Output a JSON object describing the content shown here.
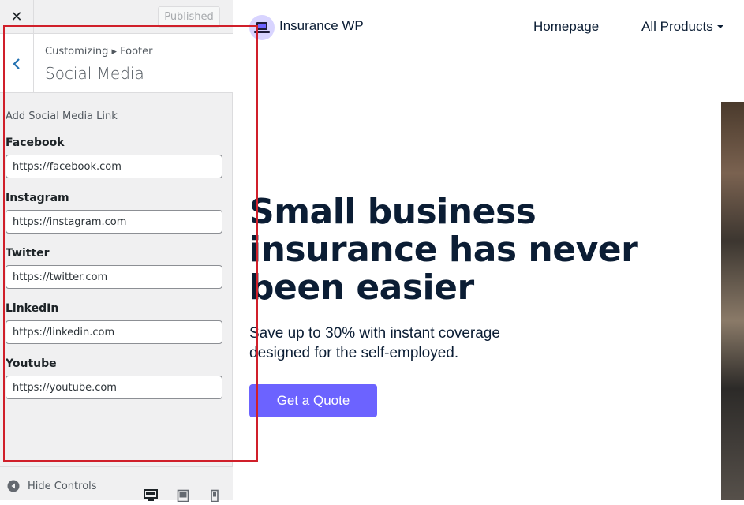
{
  "sidebar": {
    "close_label": "✕",
    "publish_label": "Published",
    "breadcrumb": "Customizing ▸ Footer",
    "section_title": "Social Media",
    "controls_description": "Add Social Media Link",
    "fields": [
      {
        "label": "Facebook",
        "value": "https://facebook.com"
      },
      {
        "label": "Instagram",
        "value": "https://instagram.com"
      },
      {
        "label": "Twitter",
        "value": "https://twitter.com"
      },
      {
        "label": "LinkedIn",
        "value": "https://linkedin.com"
      },
      {
        "label": "Youtube",
        "value": "https://youtube.com"
      }
    ],
    "hide_controls_label": "Hide Controls",
    "devices": [
      "desktop-icon",
      "tablet-icon",
      "mobile-icon"
    ]
  },
  "preview": {
    "brand_name": "Insurance WP",
    "nav": {
      "home": "Homepage",
      "products": "All Products"
    },
    "hero": {
      "title": "Small business insurance has never been easier",
      "subtitle": "Save up to 30% with instant coverage designed for the self-employed.",
      "cta_label": "Get a Quote"
    }
  },
  "colors": {
    "accent": "#6c63ff",
    "highlight": "#d01f2a",
    "heading": "#0b1d34",
    "wp_blue": "#2271b1"
  }
}
